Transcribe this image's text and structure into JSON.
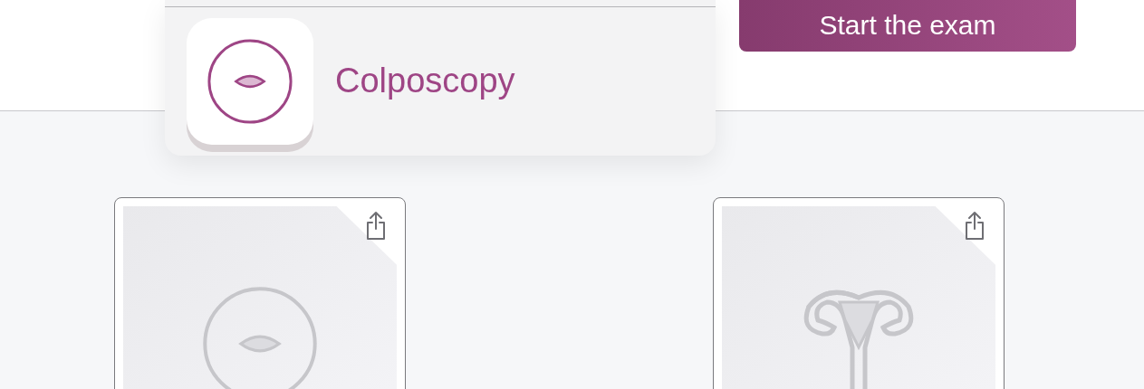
{
  "header": {
    "start_button": "Start the exam"
  },
  "dropdown": {
    "items": [
      {
        "label": "Colposcopy",
        "kind": "cervix"
      }
    ]
  },
  "cards": [
    {
      "kind": "cervix"
    },
    {
      "kind": "uterus"
    }
  ]
}
